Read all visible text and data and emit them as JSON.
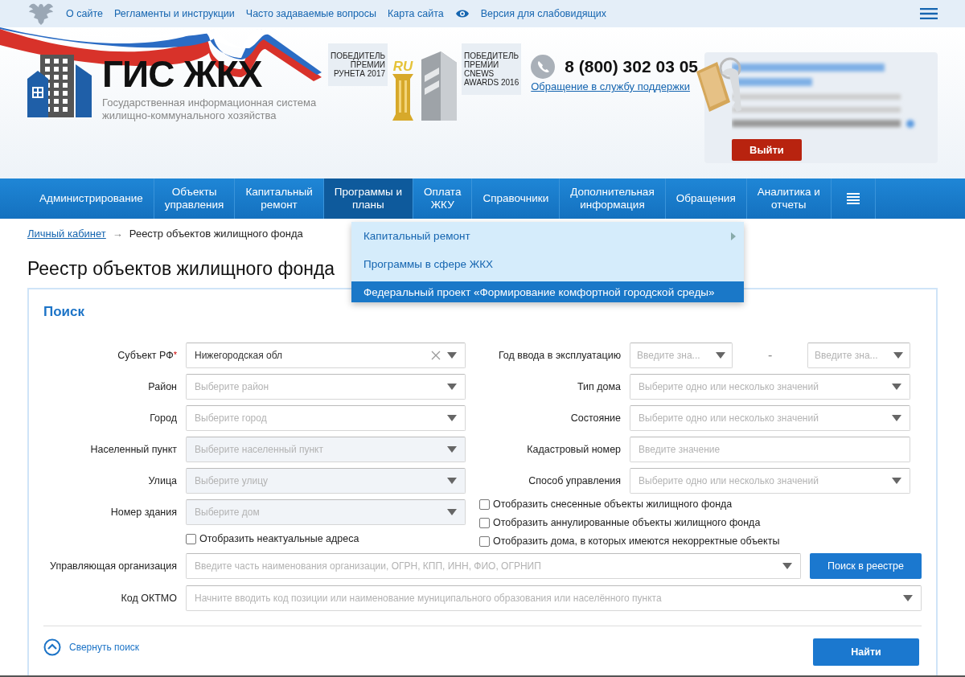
{
  "top_links": [
    {
      "label": "О сайте"
    },
    {
      "label": "Регламенты и инструкции"
    },
    {
      "label": "Часто задаваемые вопросы"
    },
    {
      "label": "Карта сайта"
    }
  ],
  "accessibility_link": "Версия для слабовидящих",
  "header": {
    "title": "ГИС ЖКХ",
    "subtitle": [
      "Государственная информационная система",
      "жилищно-коммунального хозяйства"
    ],
    "awards": [
      {
        "kind": "trophy",
        "lines": [
          "ПОБЕДИТЕЛЬ",
          "ПРЕМИИ",
          "РУНЕТА 2017"
        ],
        "badge": "RU"
      },
      {
        "kind": "crystal",
        "lines": [
          "ПОБЕДИТЕЛЬ",
          "ПРЕМИИ",
          "CNEWS",
          "AWARDS 2016"
        ]
      }
    ],
    "phone": "8 (800) 302 03 05",
    "support_link": "Обращение в службу поддержки",
    "logout_button": "Выйти"
  },
  "nav": [
    {
      "lines": [
        "Администрирование"
      ],
      "selected": false
    },
    {
      "lines": [
        "Объекты",
        "управления"
      ],
      "selected": false
    },
    {
      "lines": [
        "Капитальный",
        "ремонт"
      ],
      "selected": false
    },
    {
      "lines": [
        "Программы и",
        "планы"
      ],
      "selected": true
    },
    {
      "lines": [
        "Оплата",
        "ЖКУ"
      ],
      "selected": false
    },
    {
      "lines": [
        "Справочники"
      ],
      "selected": false
    },
    {
      "lines": [
        "Дополнительная",
        "информация"
      ],
      "selected": false
    },
    {
      "lines": [
        "Обращения"
      ],
      "selected": false
    },
    {
      "lines": [
        "Аналитика и",
        "отчеты"
      ],
      "selected": false
    }
  ],
  "dropdown": [
    {
      "label": "Капитальный ремонт",
      "selected": false,
      "has_submenu": true
    },
    {
      "label": "Программы в сфере ЖКХ",
      "selected": false,
      "has_submenu": false
    },
    {
      "label": "Федеральный проект «Формирование комфортной городской среды»",
      "selected": true,
      "has_submenu": false
    }
  ],
  "breadcrumb": {
    "link": "Личный кабинет",
    "arrow": "→",
    "current": "Реестр объектов жилищного фонда"
  },
  "page_title": "Реестр объектов жилищного фонда",
  "search": {
    "title": "Поиск",
    "left_fields": [
      {
        "label": "Субъект РФ",
        "required_mark": "*",
        "kind": "select",
        "value": "Нижегородская обл",
        "clearable": true,
        "disabled": false
      },
      {
        "label": "Район",
        "kind": "select",
        "placeholder": "Выберите район",
        "clearable": false,
        "disabled": false
      },
      {
        "label": "Город",
        "kind": "select",
        "placeholder": "Выберите город",
        "clearable": false,
        "disabled": false
      },
      {
        "label": "Населенный пункт",
        "kind": "select",
        "placeholder": "Выберите населенный пункт",
        "clearable": false,
        "disabled": true
      },
      {
        "label": "Улица",
        "kind": "select",
        "placeholder": "Выберите улицу",
        "clearable": false,
        "disabled": true
      },
      {
        "label": "Номер здания",
        "kind": "select",
        "placeholder": "Выберите дом",
        "clearable": false,
        "disabled": true
      }
    ],
    "left_checkboxes": [
      {
        "label": "Отобразить неактуальные адреса",
        "checked": false
      }
    ],
    "right_fields": [
      {
        "label": "Год ввода в эксплуатацию",
        "kind": "range",
        "from_placeholder": "Введите зна...",
        "separator": "-",
        "to_placeholder": "Введите зна...",
        "disabled": false
      },
      {
        "label": "Тип дома",
        "kind": "select",
        "placeholder": "Выберите одно или несколько значений",
        "clearable": false,
        "disabled": false
      },
      {
        "label": "Состояние",
        "kind": "select",
        "placeholder": "Выберите одно или несколько значений",
        "clearable": false,
        "disabled": false
      },
      {
        "label": "Кадастровый номер",
        "kind": "text",
        "placeholder": "Введите значение",
        "disabled": false
      },
      {
        "label": "Способ управления",
        "kind": "select",
        "placeholder": "Выберите одно или несколько значений",
        "clearable": false,
        "disabled": false
      }
    ],
    "right_checkboxes": [
      {
        "label": "Отобразить снесенные объекты жилищного фонда",
        "checked": false
      },
      {
        "label": "Отобразить аннулированные объекты жилищного фонда",
        "checked": false
      },
      {
        "label": "Отобразить дома, в которых имеются некорректные объекты",
        "checked": false
      }
    ],
    "org_field": {
      "label": "Управляющая организация",
      "placeholder": "Введите часть наименования организации, ОГРН, КПП, ИНН, ФИО, ОГРНИП"
    },
    "registry_button": "Поиск в реестре",
    "oktmo_field": {
      "label": "Код ОКТМО",
      "placeholder": "Начните вводить код позиции или наименование муниципального образования или населённого пункта"
    },
    "collapse_link": "Свернуть поиск",
    "find_button": "Найти"
  }
}
